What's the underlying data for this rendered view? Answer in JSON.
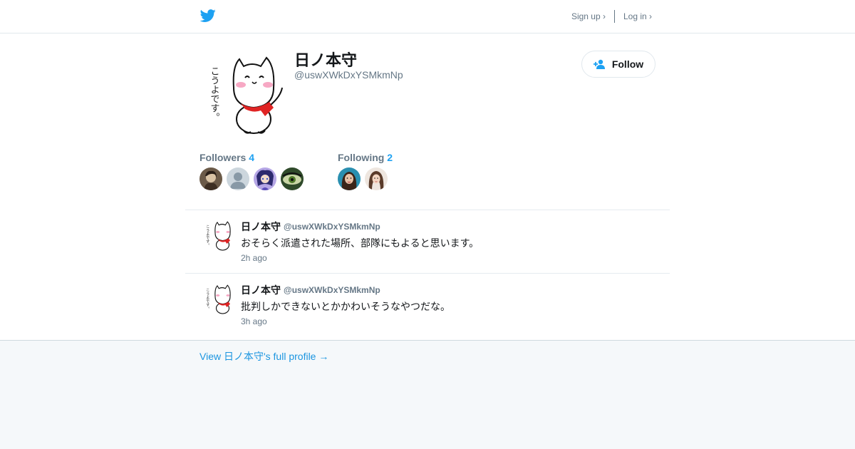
{
  "header": {
    "signup_label": "Sign up ›",
    "login_label": "Log in ›",
    "brand_color": "#1da1f2"
  },
  "profile": {
    "name": "日ノ本守",
    "handle": "@uswXWkDxYSMkmNp",
    "follow_label": "Follow",
    "avatar_caption": "こうよです。"
  },
  "followers": {
    "label": "Followers",
    "count": "4",
    "avatars": [
      "follower-1",
      "follower-2",
      "follower-3",
      "follower-4"
    ]
  },
  "following": {
    "label": "Following",
    "count": "2",
    "avatars": [
      "following-1",
      "following-2"
    ]
  },
  "tweets": [
    {
      "name": "日ノ本守",
      "handle": "@uswXWkDxYSMkmNp",
      "text": "おそらく派遣された場所、部隊にもよると思います。",
      "time": "2h ago"
    },
    {
      "name": "日ノ本守",
      "handle": "@uswXWkDxYSMkmNp",
      "text": "批判しかできないとかかわいそうなやつだな。",
      "time": "3h ago"
    }
  ],
  "footer": {
    "full_profile_label": "View 日ノ本守's full profile →"
  }
}
